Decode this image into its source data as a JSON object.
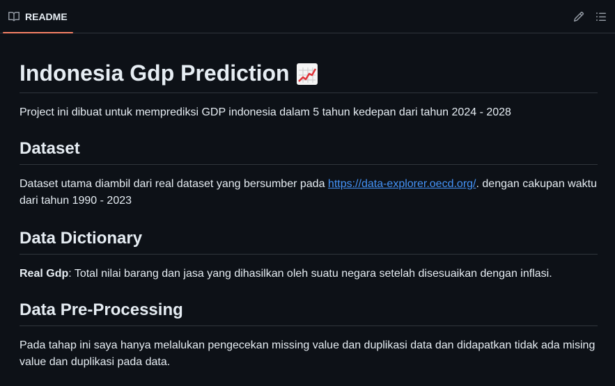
{
  "tab": {
    "label": "README",
    "icon": "book-icon"
  },
  "tools": {
    "edit_icon": "pencil-icon",
    "outline_icon": "list-icon"
  },
  "readme": {
    "title": "Indonesia Gdp Prediction",
    "title_emoji": "chart-increasing-emoji",
    "intro": "Project ini dibuat untuk memprediksi GDP indonesia dalam 5 tahun kedepan dari tahun 2024 - 2028",
    "dataset_heading": "Dataset",
    "dataset_text_before": "Dataset utama diambil dari real dataset yang bersumber pada ",
    "dataset_link": "https://data-explorer.oecd.org/",
    "dataset_text_after": ". dengan cakupan waktu dari tahun 1990 - 2023",
    "dictionary_heading": "Data Dictionary",
    "dictionary_term": "Real Gdp",
    "dictionary_definition": ": Total nilai barang dan jasa yang dihasilkan oleh suatu negara setelah disesuaikan dengan inflasi.",
    "preprocessing_heading": "Data Pre-Processing",
    "preprocessing_text": "Pada tahap ini saya hanya melalukan pengecekan missing value dan duplikasi data dan didapatkan tidak ada mising value dan duplikasi pada data."
  },
  "colors": {
    "accent": "#f78166",
    "link": "#4493f8",
    "background": "#0d1117"
  }
}
